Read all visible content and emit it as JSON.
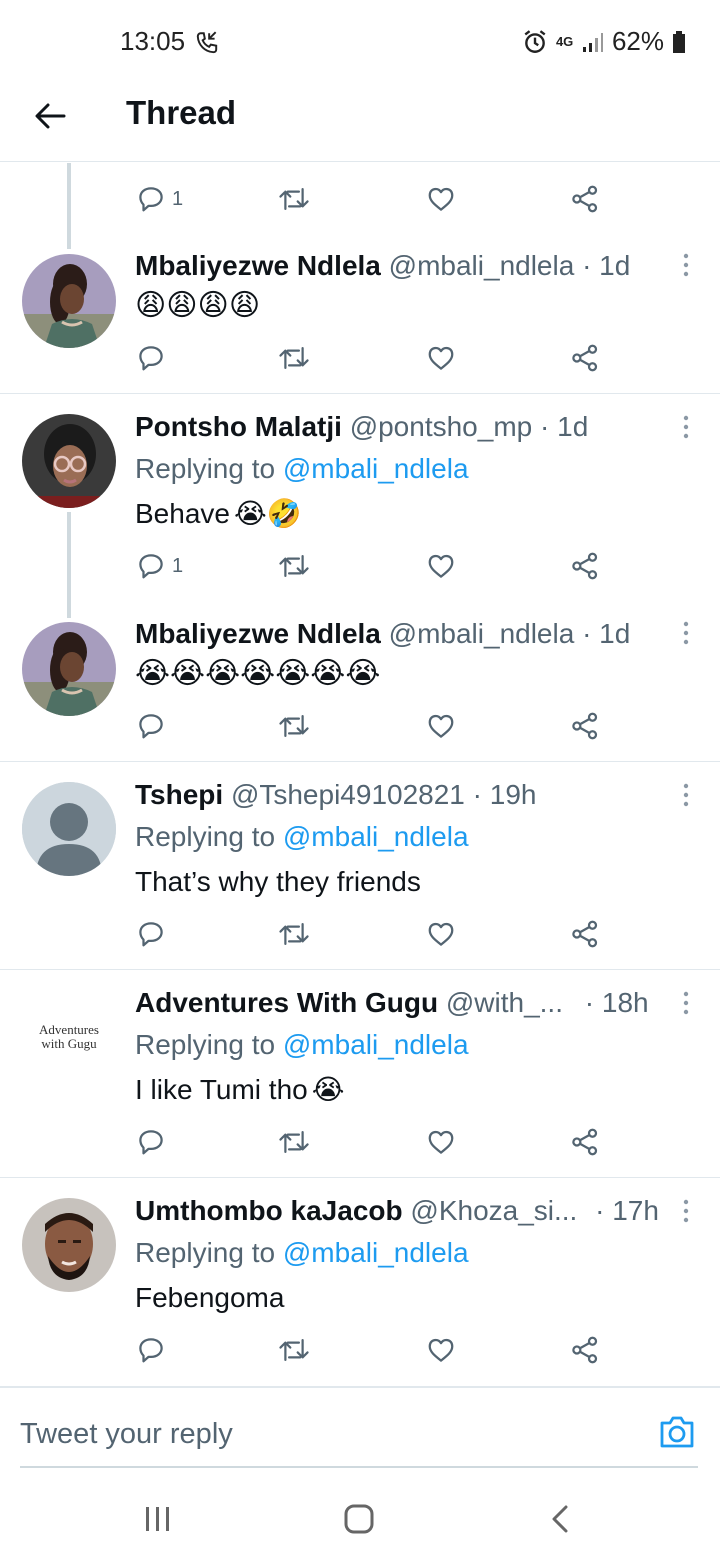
{
  "status_bar": {
    "time": "13:05",
    "network": "4G",
    "battery": "62%"
  },
  "header": {
    "title": "Thread"
  },
  "top_actions": {
    "reply_count": "1"
  },
  "tweets": [
    {
      "name": "Mbaliyezwe Ndlela",
      "handle": "@mbali_ndlela",
      "time": "· 1d",
      "text": "😩😩😩😩",
      "reply_count": ""
    },
    {
      "name": "Pontsho Malatji",
      "handle": "@pontsho_mp",
      "time": "· 1d",
      "replying_prefix": "Replying to",
      "replying_to": "@mbali_ndlela",
      "text": "Behave",
      "emoji": "😭🤣",
      "reply_count": "1"
    },
    {
      "name": "Mbaliyezwe Ndlela",
      "handle": "@mbali_ndlela",
      "time": "· 1d",
      "text": "😭😭😭😭😭😭😭",
      "reply_count": ""
    },
    {
      "name": "Tshepi",
      "handle": "@Tshepi49102821",
      "time": "· 19h",
      "replying_prefix": "Replying to",
      "replying_to": "@mbali_ndlela",
      "text": "That’s why they friends",
      "reply_count": ""
    },
    {
      "name": "Adventures With Gugu",
      "handle": "@with_...",
      "time": "· 18h",
      "replying_prefix": "Replying to",
      "replying_to": "@mbali_ndlela",
      "text": "I like Tumi tho",
      "emoji": "😭",
      "reply_count": "",
      "avatar_text_line1": "Adventures",
      "avatar_text_line2": "with Gugu"
    },
    {
      "name": "Umthombo kaJacob",
      "handle": "@Khoza_si...",
      "time": "· 17h",
      "replying_prefix": "Replying to",
      "replying_to": "@mbali_ndlela",
      "text": "Febengoma",
      "reply_count": ""
    }
  ],
  "reply_bar": {
    "placeholder": "Tweet your reply"
  },
  "colors": {
    "accent": "#1d9bf0",
    "secondary_text": "#536471",
    "divider": "#e1e8ed"
  },
  "icons": [
    "phone-call-icon",
    "alarm-icon",
    "signal-icon",
    "battery-icon",
    "back-arrow-icon",
    "reply-icon",
    "retweet-icon",
    "like-icon",
    "share-icon",
    "more-icon",
    "camera-icon",
    "recents-icon",
    "home-icon",
    "nav-back-icon"
  ]
}
